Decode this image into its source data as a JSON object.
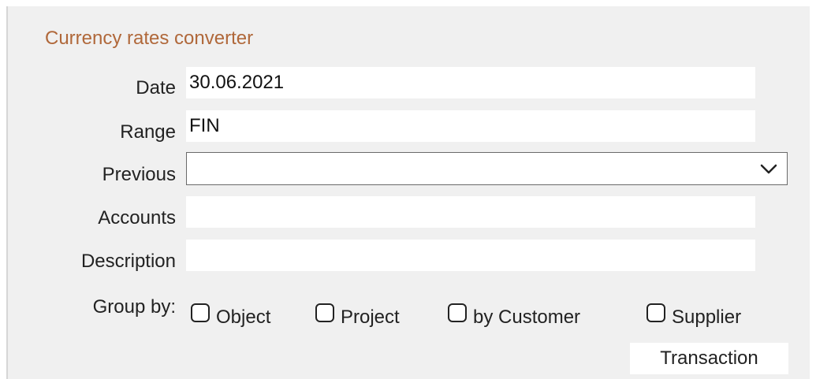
{
  "form": {
    "title": "Currency rates converter",
    "date": {
      "label": "Date",
      "value": "30.06.2021"
    },
    "range": {
      "label": "Range",
      "value": "FIN"
    },
    "previous": {
      "label": "Previous",
      "value": "",
      "icon": "chevron-down-icon"
    },
    "accounts": {
      "label": "Accounts",
      "value": ""
    },
    "description": {
      "label": "Description",
      "value": ""
    },
    "group_by": {
      "label": "Group by:",
      "options": [
        {
          "label": "Object",
          "checked": false
        },
        {
          "label": "Project",
          "checked": false
        },
        {
          "label": "by Customer",
          "checked": false
        },
        {
          "label": "Supplier",
          "checked": false
        }
      ]
    },
    "transaction_button": "Transaction"
  },
  "colors": {
    "panel_background": "#f0f0f0",
    "title": "#b0683a",
    "field_background": "#ffffff"
  }
}
